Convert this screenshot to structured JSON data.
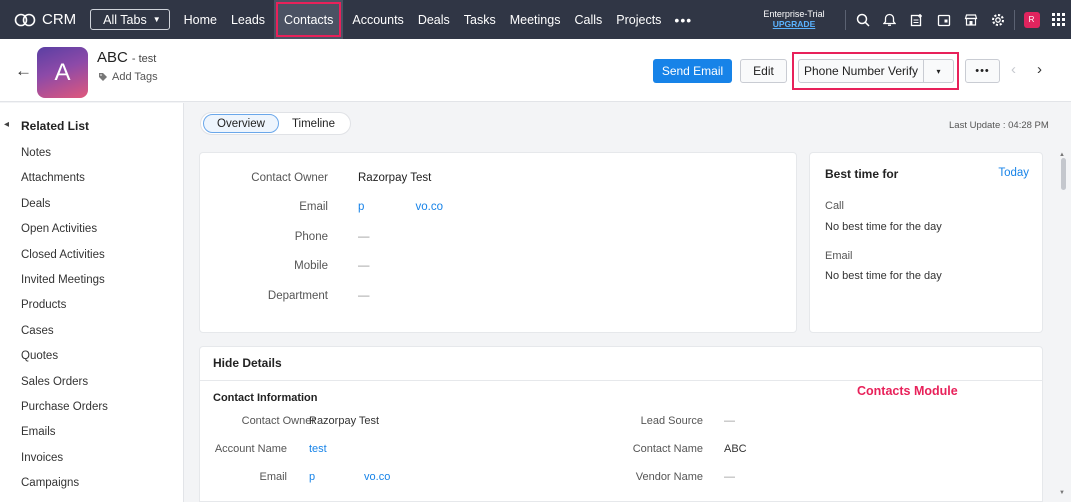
{
  "topbar": {
    "brand": "CRM",
    "all_tabs": "All Tabs",
    "nav": [
      {
        "label": "Home",
        "active": false
      },
      {
        "label": "Leads",
        "active": false
      },
      {
        "label": "Contacts",
        "active": true
      },
      {
        "label": "Accounts",
        "active": false
      },
      {
        "label": "Deals",
        "active": false
      },
      {
        "label": "Tasks",
        "active": false
      },
      {
        "label": "Meetings",
        "active": false
      },
      {
        "label": "Calls",
        "active": false
      },
      {
        "label": "Projects",
        "active": false
      }
    ],
    "more": "•••",
    "trial_label": "Enterprise-Trial",
    "upgrade": "UPGRADE",
    "user_initial": "R",
    "highlight_color": "#e8215a",
    "bg_color": "#303645"
  },
  "record": {
    "avatar_letter": "A",
    "name": "ABC",
    "sub": "- test",
    "add_tags": "Add Tags",
    "send_email": "Send Email",
    "edit": "Edit",
    "phone_verify": "Phone Number Verify",
    "dd_arrow": "▾",
    "more": "•••"
  },
  "sidebar": {
    "title": "Related List",
    "items": [
      "Notes",
      "Attachments",
      "Deals",
      "Open Activities",
      "Closed Activities",
      "Invited Meetings",
      "Products",
      "Cases",
      "Quotes",
      "Sales Orders",
      "Purchase Orders",
      "Emails",
      "Invoices",
      "Campaigns"
    ]
  },
  "main": {
    "tabs": [
      "Overview",
      "Timeline"
    ],
    "last_update": "Last Update : 04:28 PM",
    "summary": {
      "fields": [
        {
          "label": "Contact Owner",
          "value": "Razorpay Test"
        },
        {
          "label": "Email",
          "value": "p                vo.co"
        },
        {
          "label": "Phone",
          "value": "—"
        },
        {
          "label": "Mobile",
          "value": "—"
        },
        {
          "label": "Department",
          "value": "—"
        }
      ]
    },
    "best_time": {
      "title": "Best time for",
      "today": "Today",
      "call_label": "Call",
      "call_value": "No best time for the day",
      "email_label": "Email",
      "email_value": "No best time for the day"
    },
    "details": {
      "hide": "Hide Details",
      "section": "Contact Information",
      "module_tag": "Contacts Module",
      "left": [
        {
          "label": "Contact Owner",
          "value": "Razorpay Test"
        },
        {
          "label": "Account Name",
          "value": "test"
        },
        {
          "label": "Email",
          "value": "p                vo.co"
        }
      ],
      "right": [
        {
          "label": "Lead Source",
          "value": "—"
        },
        {
          "label": "Contact Name",
          "value": "ABC"
        },
        {
          "label": "Vendor Name",
          "value": "—"
        }
      ]
    }
  }
}
